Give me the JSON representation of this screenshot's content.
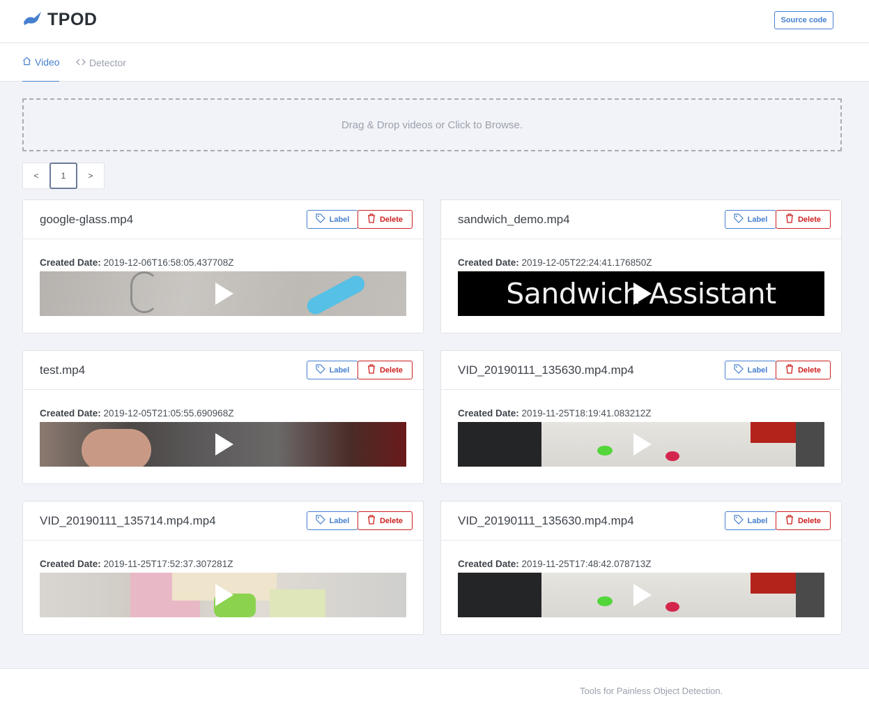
{
  "app": {
    "title": "TPOD",
    "source_button": "Source code"
  },
  "nav": {
    "tabs": [
      {
        "label": "Video"
      },
      {
        "label": "Detector"
      }
    ]
  },
  "dropzone": {
    "text": "Drag & Drop videos or Click to Browse."
  },
  "pagination": {
    "prev": "<",
    "page": "1",
    "next": ">"
  },
  "card_actions": {
    "label": "Label",
    "delete": "Delete",
    "created_prefix": "Created Date:"
  },
  "videos": [
    {
      "name": "google-glass.mp4",
      "created": "2019-12-06T16:58:05.437708Z"
    },
    {
      "name": "sandwich_demo.mp4",
      "created": "2019-12-05T22:24:41.176850Z",
      "thumb_text": "Sandwich Assistant"
    },
    {
      "name": "test.mp4",
      "created": "2019-12-05T21:05:55.690968Z"
    },
    {
      "name": "VID_20190111_135630.mp4.mp4",
      "created": "2019-11-25T18:19:41.083212Z"
    },
    {
      "name": "VID_20190111_135714.mp4.mp4",
      "created": "2019-11-25T17:52:37.307281Z"
    },
    {
      "name": "VID_20190111_135630.mp4.mp4",
      "created": "2019-11-25T17:48:42.078713Z"
    }
  ],
  "footer": {
    "text": "Tools for Painless Object Detection."
  },
  "colors": {
    "primary": "#467fcf",
    "danger": "#cd201f",
    "background": "#f2f3f8"
  }
}
